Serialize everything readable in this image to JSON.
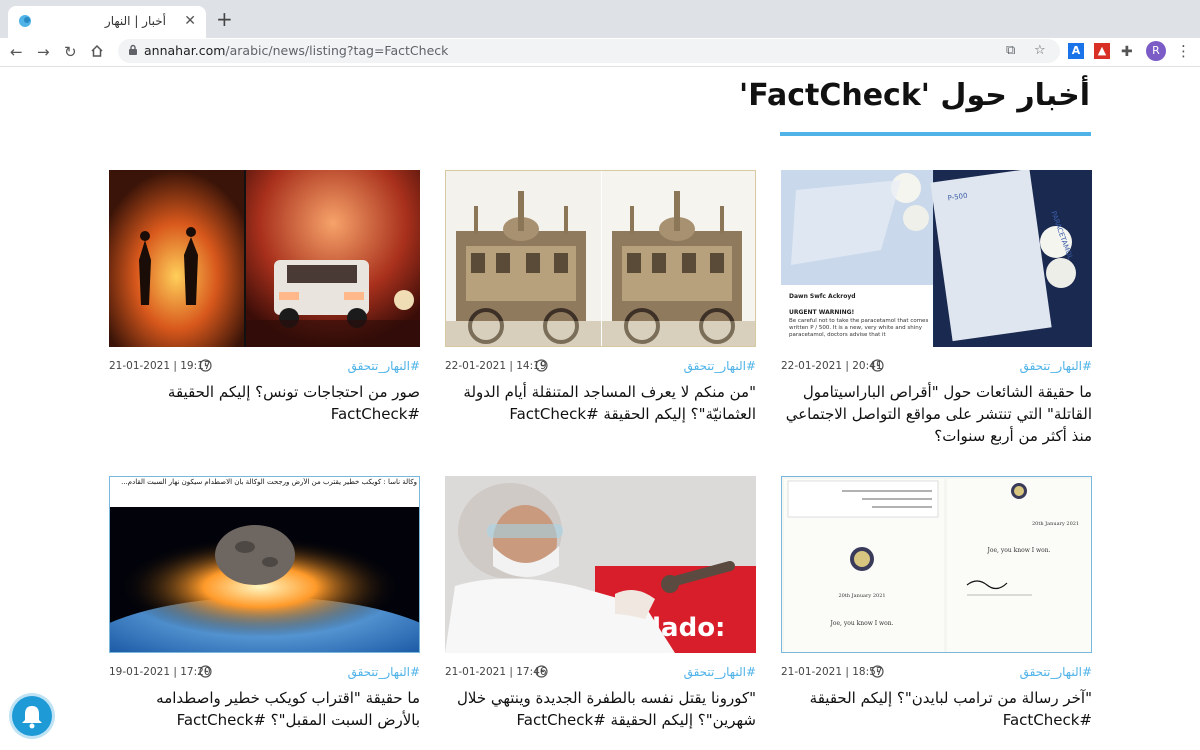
{
  "browser": {
    "tab_title": "أخبار | النهار",
    "url_domain": "annahar.com",
    "url_path": "/arabic/news/listing?tag=FactCheck",
    "avatar_letter": "R"
  },
  "page": {
    "heading": "أخبار حول 'FactCheck'"
  },
  "articles": [
    {
      "tag": "#النهار_تتحقق",
      "date": "22-01-2021 | 20:41",
      "title": "ما حقيقة الشائعات حول \"أقراص الباراسيتامول القاتلة\" التي تنتشر على مواقع التواصل الاجتماعي منذ أكثر من أربع سنوات؟",
      "image": "paracetamol-tablets-photo"
    },
    {
      "tag": "#النهار_تتحقق",
      "date": "22-01-2021 | 14:19",
      "title": "\"من منكم لا يعرف المساجد المتنقلة أيام الدولة العثمانيّة\"؟ إليكم الحقيقة #FactCheck",
      "image": "mobile-mosque-photo"
    },
    {
      "tag": "#النهار_تتحقق",
      "date": "21-01-2021 | 19:17",
      "title": "صور من احتجاجات تونس؟ إليكم الحقيقة #FactCheck",
      "image": "protest-fire-photo"
    },
    {
      "tag": "#النهار_تتحقق",
      "date": "21-01-2021 | 18:57",
      "title": "\"آخر رسالة من ترامب لبايدن\"؟ إليكم الحقيقة #FactCheck",
      "image": "letter-document-photo"
    },
    {
      "tag": "#النهار_تتحقق",
      "date": "21-01-2021 | 17:46",
      "title": "\"كورونا يقتل نفسه بالطفرة الجديدة وينتهي خلال شهرين\"؟ إليكم الحقيقة #FactCheck",
      "image": "vaccination-photo"
    },
    {
      "tag": "#النهار_تتحقق",
      "date": "19-01-2021 | 17:20",
      "title": "ما حقيقة \"اقتراب كويكب خطير واصطدامه بالأرض السبت المقبل\"؟ #FactCheck",
      "image": "asteroid-impact-photo"
    }
  ],
  "article_images": {
    "paracetamol": {
      "caption_name": "Dawn Swfc Ackroyd",
      "caption_warning": "URGENT WARNING!",
      "caption_body": "Be careful not to take the paracetamol that comes written P / 500. It is a new, very white and shiny paracetamol, doctors advise that it"
    },
    "letter": {
      "line": "Joe, you know I won.",
      "date": "20th January 2021"
    },
    "asteroid": {
      "caption": "وكالة ناسا : كويكب خطير يقترب من الأرض ورجحت الوكالة بأن الاصطدام سيكون نهار السبت القادم..."
    },
    "vaccination": {
      "banner": "uidado:"
    }
  },
  "colors": {
    "accent": "#4fb3e8",
    "tab_bar": "#dee1e6",
    "bell": "#1e9bd7"
  }
}
